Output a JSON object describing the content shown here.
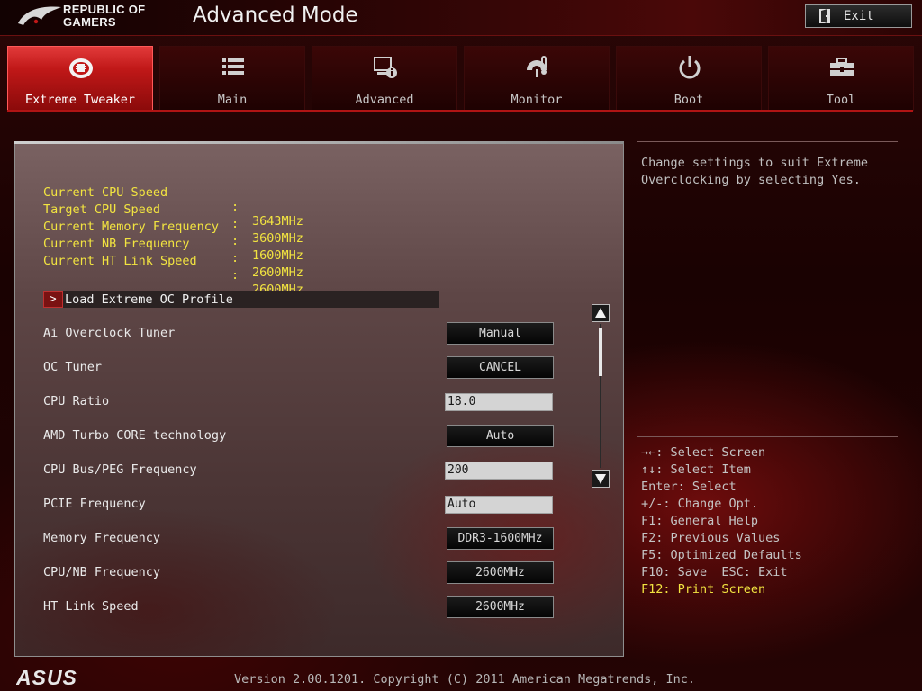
{
  "header": {
    "brand_line1": "REPUBLIC OF",
    "brand_line2": "GAMERS",
    "mode_title": "Advanced Mode",
    "exit_label": "Exit"
  },
  "tabs": [
    {
      "label": "Extreme Tweaker",
      "icon": "tweaker-icon",
      "active": true
    },
    {
      "label": "Main",
      "icon": "list-icon",
      "active": false
    },
    {
      "label": "Advanced",
      "icon": "advanced-icon",
      "active": false
    },
    {
      "label": "Monitor",
      "icon": "monitor-gauge-icon",
      "active": false
    },
    {
      "label": "Boot",
      "icon": "power-icon",
      "active": false
    },
    {
      "label": "Tool",
      "icon": "toolbox-icon",
      "active": false
    }
  ],
  "info": [
    {
      "key": "Current CPU Speed",
      "sep": ":",
      "value": "3643MHz"
    },
    {
      "key": "Target CPU Speed",
      "sep": ":",
      "value": "3600MHz"
    },
    {
      "key": "Current Memory Frequency",
      "sep": ":",
      "value": "1600MHz"
    },
    {
      "key": "Current NB Frequency",
      "sep": ":",
      "value": "2600MHz"
    },
    {
      "key": "Current HT Link Speed",
      "sep": ":",
      "value": "2600MHz"
    }
  ],
  "load_profile": {
    "arrow": ">",
    "label": "Load Extreme OC Profile"
  },
  "settings": [
    {
      "label": "Ai Overclock Tuner",
      "value": "Manual",
      "kind": "button"
    },
    {
      "label": "OC Tuner",
      "value": "CANCEL",
      "kind": "button"
    },
    {
      "label": "CPU Ratio",
      "value": "18.0",
      "kind": "input"
    },
    {
      "label": "AMD Turbo CORE technology",
      "value": "Auto",
      "kind": "button"
    },
    {
      "label": "CPU Bus/PEG Frequency",
      "value": "200",
      "kind": "input"
    },
    {
      "label": "PCIE Frequency",
      "value": "Auto",
      "kind": "input"
    },
    {
      "label": "Memory Frequency",
      "value": "DDR3-1600MHz",
      "kind": "button"
    },
    {
      "label": "CPU/NB Frequency",
      "value": "2600MHz",
      "kind": "button"
    },
    {
      "label": "HT Link Speed",
      "value": "2600MHz",
      "kind": "button"
    }
  ],
  "help": {
    "text": "Change settings to suit Extreme Overclocking by selecting Yes."
  },
  "keys": [
    {
      "text": "→←: Select Screen",
      "highlight": false
    },
    {
      "text": "↑↓: Select Item",
      "highlight": false
    },
    {
      "text": "Enter: Select",
      "highlight": false
    },
    {
      "text": "+/-: Change Opt.",
      "highlight": false
    },
    {
      "text": "F1: General Help",
      "highlight": false
    },
    {
      "text": "F2: Previous Values",
      "highlight": false
    },
    {
      "text": "F5: Optimized Defaults",
      "highlight": false
    },
    {
      "text": "F10: Save  ESC: Exit",
      "highlight": false
    },
    {
      "text": "F12: Print Screen",
      "highlight": true
    }
  ],
  "footer": {
    "brand": "ASUS",
    "version": "Version 2.00.1201. Copyright (C) 2011 American Megatrends, Inc."
  },
  "colors": {
    "accent_red": "#c01818",
    "info_yellow": "#f2e440"
  }
}
